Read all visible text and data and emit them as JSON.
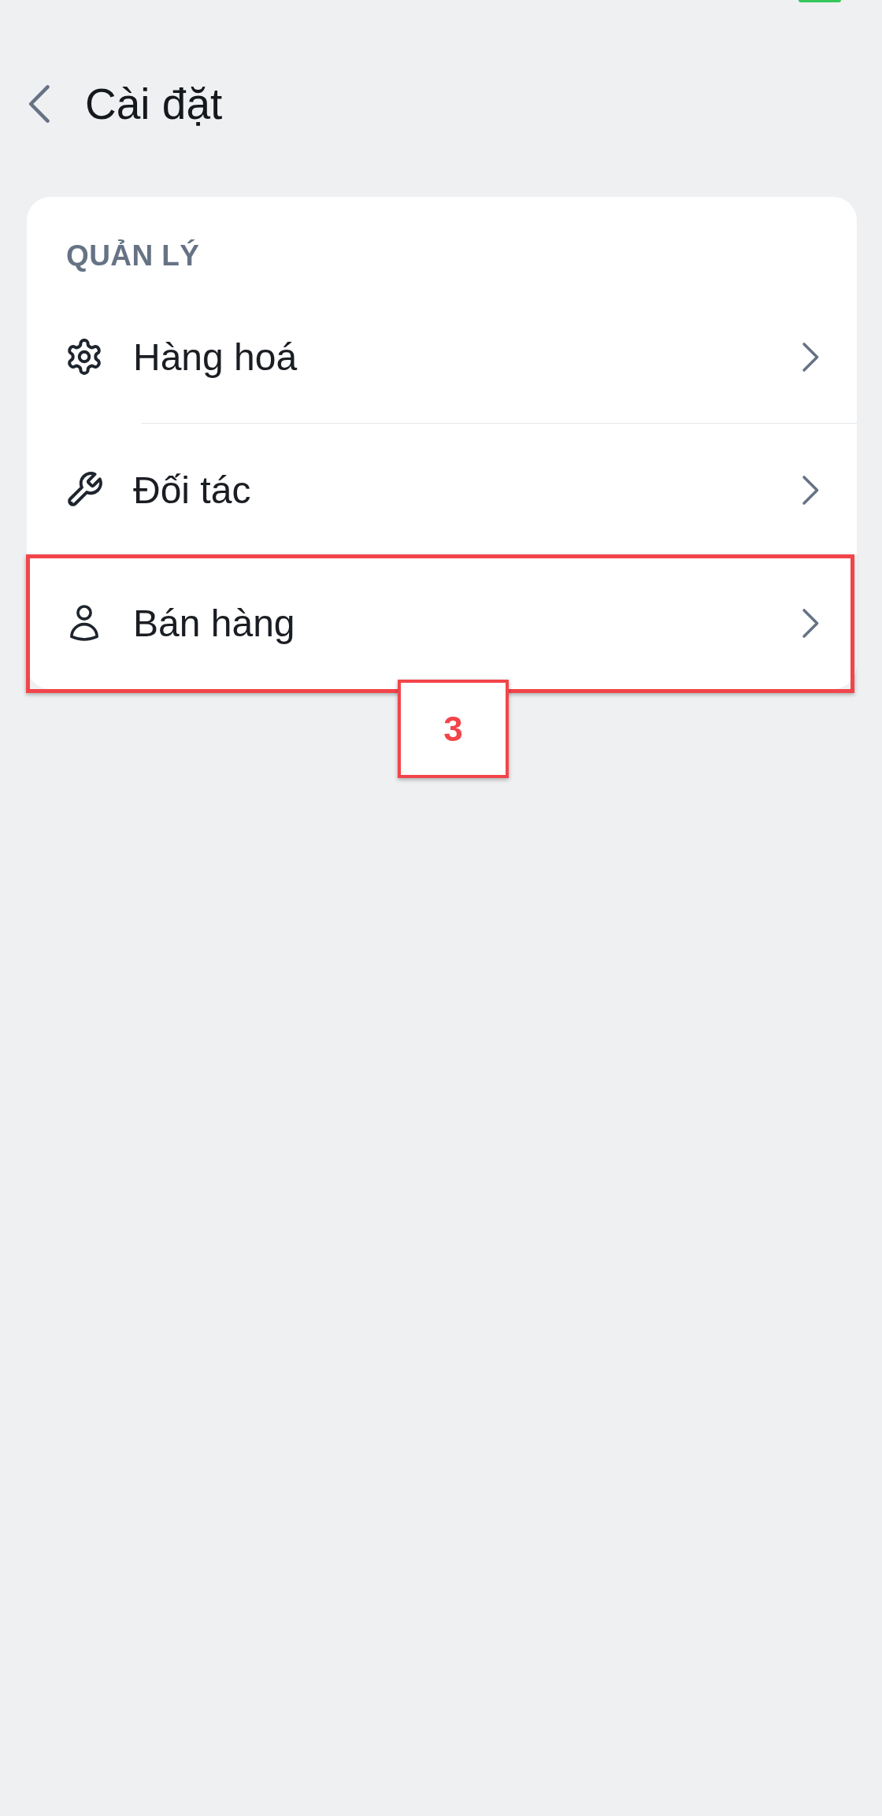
{
  "header": {
    "title": "Cài đặt"
  },
  "section": {
    "title": "QUẢN LÝ",
    "items": [
      {
        "label": "Hàng hoá",
        "highlighted": false
      },
      {
        "label": "Đối tác",
        "highlighted": false
      },
      {
        "label": "Bán hàng",
        "highlighted": true,
        "callout": "3"
      }
    ]
  }
}
